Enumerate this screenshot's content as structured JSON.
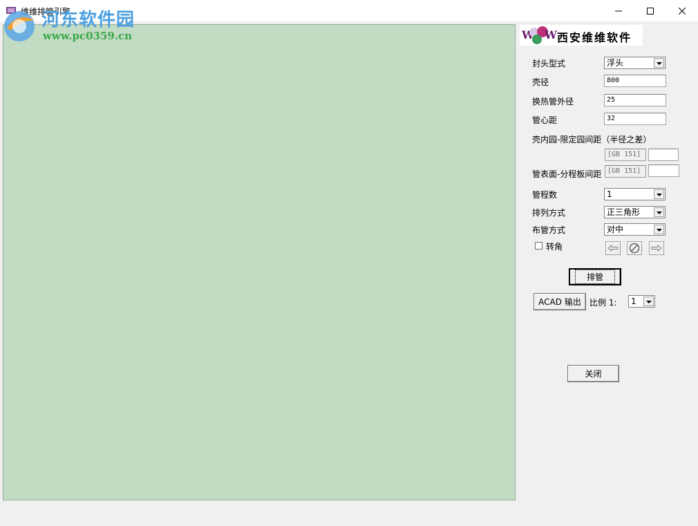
{
  "window": {
    "title": "维维排管引擎"
  },
  "watermark": {
    "site_name": "河东软件园",
    "url": "www.pc0359.cn"
  },
  "brand": {
    "text": "西安维维软件",
    "letter_w": "W"
  },
  "form": {
    "head_type": {
      "label": "封头型式",
      "value": "浮头"
    },
    "shell_diameter": {
      "label": "壳径",
      "value": "800"
    },
    "tube_od": {
      "label": "换热管外径",
      "value": "25"
    },
    "pitch": {
      "label": "管心距",
      "value": "32"
    },
    "shell_limit_label": "壳内园-限定园间距（半径之差）",
    "shell_limit": {
      "standard": "[GB 151]",
      "value": ""
    },
    "tube_plate": {
      "label": "管表面-分程板间距",
      "standard": "[GB 151]",
      "value": ""
    },
    "passes": {
      "label": "管程数",
      "value": "1"
    },
    "arrangement": {
      "label": "排列方式",
      "value": "正三角形"
    },
    "layout": {
      "label": "布管方式",
      "value": "对中"
    },
    "rotate": {
      "label": "转角",
      "checked": false
    }
  },
  "buttons": {
    "arrange": "排管",
    "acad_export": "ACAD 输出",
    "close": "关闭"
  },
  "scale": {
    "label": "比例 1:",
    "value": "1"
  },
  "colors": {
    "canvas": "#c2dcc3",
    "panel": "#f0f0f0",
    "watermark_blue": "#4a9fe0",
    "watermark_green": "#3aa64a"
  }
}
